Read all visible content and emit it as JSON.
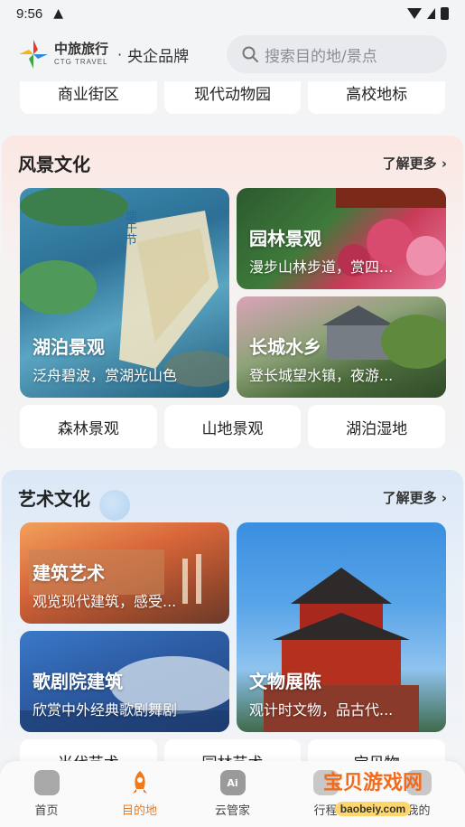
{
  "status": {
    "time": "9:56"
  },
  "header": {
    "logo_cn": "中旅旅行",
    "logo_en": "CTG TRAVEL",
    "separator": "·",
    "brand": "央企品牌",
    "search_placeholder": "搜索目的地/景点"
  },
  "top_chips": [
    "商业街区",
    "现代动物园",
    "高校地标"
  ],
  "scenery": {
    "title": "风景文化",
    "more": "了解更多 ›",
    "tiles": [
      {
        "title": "湖泊景观",
        "subtitle": "泛舟碧波，赏湖光山色"
      },
      {
        "title": "园林景观",
        "subtitle": "漫步山林步道，赏四..."
      },
      {
        "title": "长城水乡",
        "subtitle": "登长城望水镇，夜游..."
      }
    ],
    "chips": [
      "森林景观",
      "山地景观",
      "湖泊湿地"
    ]
  },
  "art": {
    "title": "艺术文化",
    "more": "了解更多 ›",
    "tiles": [
      {
        "title": "建筑艺术",
        "subtitle": "观览现代建筑，感受..."
      },
      {
        "title": "歌剧院建筑",
        "subtitle": "欣赏中外经典歌剧舞剧"
      },
      {
        "title": "文物展陈",
        "subtitle": "观计时文物，品古代..."
      }
    ],
    "chips": [
      "当代艺术",
      "园林艺术",
      "宝贝物"
    ]
  },
  "bottom_nav": [
    {
      "label": "首页",
      "icon": "home-icon"
    },
    {
      "label": "目的地",
      "icon": "rocket-icon"
    },
    {
      "label": "云管家",
      "icon": "ai-icon"
    },
    {
      "label": "行程",
      "icon": "trip-icon"
    },
    {
      "label": "我的",
      "icon": "profile-icon"
    }
  ],
  "watermark": {
    "cn": "宝贝游戏网",
    "en": "baobeiy.com"
  },
  "colors": {
    "accent": "#f07a1a"
  }
}
